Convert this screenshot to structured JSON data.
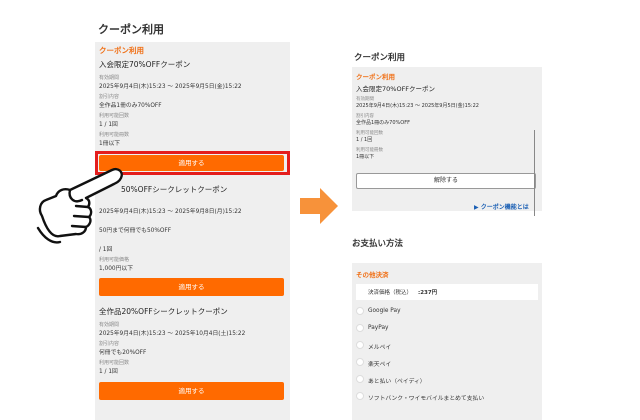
{
  "left": {
    "page_title": "クーポン利用",
    "section_heading": "クーポン利用",
    "coupons": [
      {
        "name": "入会限定70%OFFクーポン",
        "period_label": "有効期間",
        "period": "2025年9月4日(木)15:23 〜 2025年9月5日(金)15:22",
        "discount_label": "割引内容",
        "discount": "全作品1冊のみ70%OFF",
        "uses_label": "利用可能回数",
        "uses": "1 / 1回",
        "count_label": "利用可能冊数",
        "count": "1冊以下",
        "button": "適用する"
      },
      {
        "name": "50%OFFシークレットクーポン",
        "period": "2025年9月4日(木)15:23 〜 2025年9月8日(月)15:22",
        "discount": "50円まで何冊でも50%OFF",
        "uses": "/ 1回",
        "price_label": "利用可能価格",
        "price": "1,000円以下",
        "button": "適用する"
      },
      {
        "name": "全作品20%OFFシークレットクーポン",
        "period_label": "有効期間",
        "period": "2025年9月4日(木)15:23 〜 2025年10月4日(土)15:22",
        "discount_label": "割引内容",
        "discount": "何冊でも20%OFF",
        "uses_label": "利用可能回数",
        "uses": "1 / 1回",
        "button": "適用する"
      }
    ]
  },
  "right": {
    "page_title": "クーポン利用",
    "section_heading": "クーポン利用",
    "coupon": {
      "name": "入会限定70%OFFクーポン",
      "period_label": "有効期間",
      "period": "2025年9月4日(木)15:23 〜 2025年9月5日(金)15:22",
      "discount_label": "割引内容",
      "discount": "全作品1冊のみ70%OFF",
      "uses_label": "利用可能回数",
      "uses": "1 / 1回",
      "count_label": "利用可能冊数",
      "count": "1冊以下",
      "button": "解除する"
    },
    "feature_link": "▶ クーポン機能とは",
    "payment_title": "お支払い方法",
    "other_heading": "その他決済",
    "price_label": "決済価格（税込）",
    "price_value": ":237円",
    "methods": [
      "Google Pay",
      "PayPay",
      "メルペイ",
      "楽天ペイ",
      "あと払い（ペイディ）",
      "ソフトバンク・ワイモバイルまとめて支払い"
    ]
  },
  "colors": {
    "accent": "#ff6a00",
    "heading_orange": "#f07016",
    "highlight_red": "#e41d1d",
    "arrow": "#f7923a",
    "link_blue": "#1a5fb4",
    "panel_gray": "#efefef"
  },
  "icons": {
    "arrow": "arrow-right-icon",
    "hand": "pointing-hand-icon"
  }
}
